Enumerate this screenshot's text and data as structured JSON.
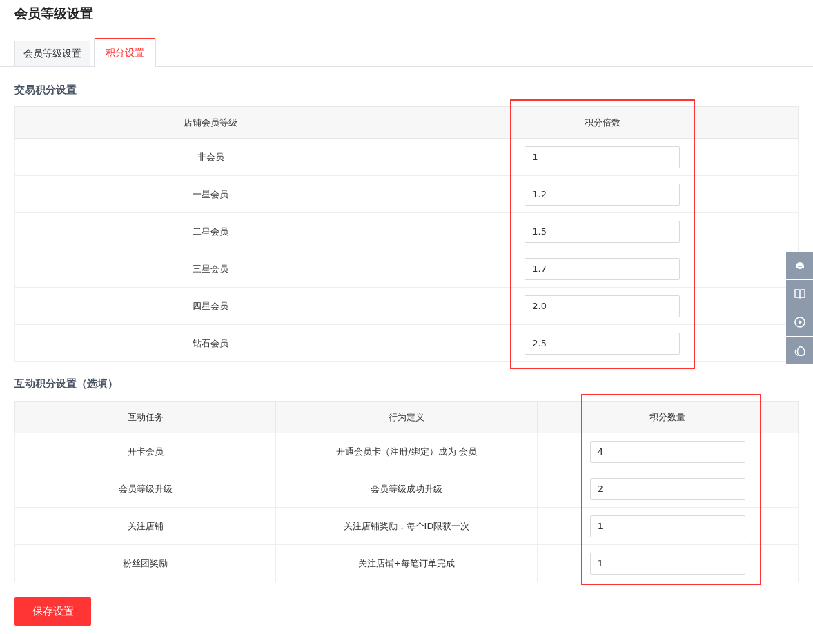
{
  "page": {
    "title": "会员等级设置"
  },
  "tabs": [
    {
      "label": "会员等级设置",
      "selected": false
    },
    {
      "label": "积分设置",
      "selected": true
    }
  ],
  "trade_points": {
    "heading": "交易积分设置",
    "columns": [
      "店铺会员等级",
      "积分倍数"
    ],
    "rows": [
      {
        "level": "非会员",
        "multiplier": "1"
      },
      {
        "level": "一星会员",
        "multiplier": "1.2"
      },
      {
        "level": "二星会员",
        "multiplier": "1.5"
      },
      {
        "level": "三星会员",
        "multiplier": "1.7"
      },
      {
        "level": "四星会员",
        "multiplier": "2.0"
      },
      {
        "level": "钻石会员",
        "multiplier": "2.5"
      }
    ]
  },
  "interaction_points": {
    "heading": "互动积分设置（选填）",
    "columns": [
      "互动任务",
      "行为定义",
      "积分数量"
    ],
    "rows": [
      {
        "task": "开卡会员",
        "definition": "开通会员卡（注册/绑定）成为 会员",
        "points": "4"
      },
      {
        "task": "会员等级升级",
        "definition": "会员等级成功升级",
        "points": "2"
      },
      {
        "task": "关注店铺",
        "definition": "关注店铺奖励，每个ID限获一次",
        "points": "1"
      },
      {
        "task": "粉丝团奖励",
        "definition": "关注店铺+每笔订单完成",
        "points": "1"
      }
    ]
  },
  "save_button": {
    "label": "保存设置"
  },
  "side_toolbar": [
    {
      "kind": "support"
    },
    {
      "kind": "book"
    },
    {
      "kind": "play"
    },
    {
      "kind": "chat"
    }
  ]
}
